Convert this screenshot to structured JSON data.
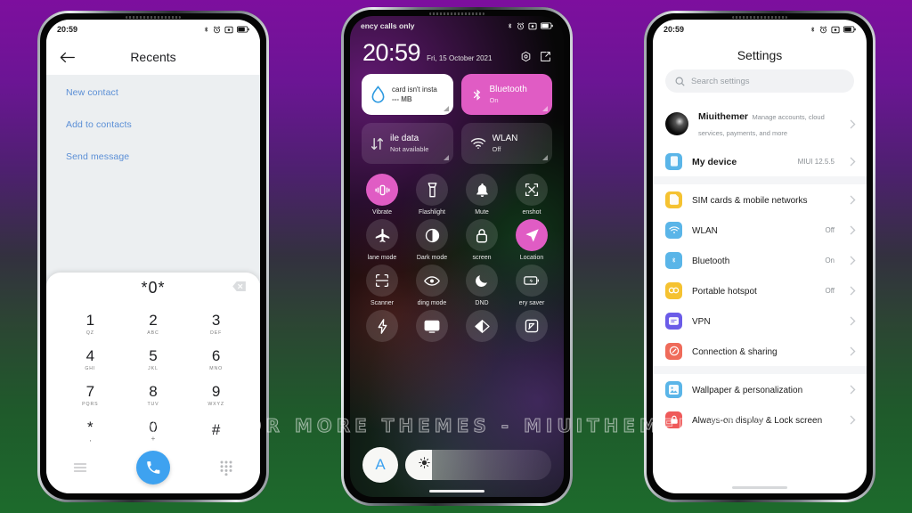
{
  "watermark": "VISIT FOR MORE THEMES - MIUITHEMER.COM",
  "theme": {
    "accent_pink": "#e05cc4",
    "accent_blue": "#3ea2f0",
    "bg_top": "#7d0f9e",
    "bg_bottom": "#1d6b2c"
  },
  "phone_left": {
    "status": {
      "time": "20:59"
    },
    "appbar": {
      "title": "Recents",
      "back_icon": "back-arrow-icon"
    },
    "links": [
      {
        "label": "New contact"
      },
      {
        "label": "Add to contacts"
      },
      {
        "label": "Send message"
      }
    ],
    "dialer": {
      "number": "*0*",
      "backspace_icon": "backspace-icon",
      "keys": [
        {
          "digit": "1",
          "sub": "QZ"
        },
        {
          "digit": "2",
          "sub": "ABC"
        },
        {
          "digit": "3",
          "sub": "DEF"
        },
        {
          "digit": "4",
          "sub": "GHI"
        },
        {
          "digit": "5",
          "sub": "JKL"
        },
        {
          "digit": "6",
          "sub": "MNO"
        },
        {
          "digit": "7",
          "sub": "PQRS"
        },
        {
          "digit": "8",
          "sub": "TUV"
        },
        {
          "digit": "9",
          "sub": "WXYZ"
        },
        {
          "digit": "*",
          "sub": ","
        },
        {
          "digit": "0",
          "sub": "+"
        },
        {
          "digit": "#",
          "sub": ""
        }
      ],
      "menu_icon": "menu-icon",
      "call_icon": "phone-call-icon",
      "keypad_icon": "keypad-grid-icon"
    }
  },
  "phone_center": {
    "status": {
      "carrier": "ency calls only"
    },
    "clock": {
      "time": "20:59",
      "date": "Fri, 15 October 2021",
      "settings_icon": "gear-icon",
      "edit_icon": "edit-pencil-icon"
    },
    "big_tiles": [
      {
        "title": "card isn't insta",
        "sub": "--- MB",
        "icon": "data-drop-icon",
        "style": "white"
      },
      {
        "title": "Bluetooth",
        "sub": "On",
        "icon": "bluetooth-icon",
        "style": "pink"
      },
      {
        "title": "ile data",
        "sub": "Not available",
        "icon": "mobile-data-icon",
        "style": "dim"
      },
      {
        "title": "WLAN",
        "sub": "Off",
        "icon": "wifi-icon",
        "style": "dim"
      }
    ],
    "toggles": [
      {
        "label": "Vibrate",
        "icon": "vibrate-icon",
        "on": true
      },
      {
        "label": "Flashlight",
        "icon": "flashlight-icon",
        "on": false
      },
      {
        "label": "Mute",
        "icon": "bell-icon",
        "on": false
      },
      {
        "label": "enshot",
        "icon": "screenshot-icon",
        "on": false
      },
      {
        "label": "lane mode",
        "icon": "airplane-icon",
        "on": false
      },
      {
        "label": "Dark mode",
        "icon": "dark-mode-icon",
        "on": false
      },
      {
        "label": "screen",
        "icon": "lock-icon",
        "on": false
      },
      {
        "label": "Location",
        "icon": "location-arrow-icon",
        "on": true
      },
      {
        "label": "Scanner",
        "icon": "scanner-icon",
        "on": false
      },
      {
        "label": "ding mode",
        "icon": "eye-icon",
        "on": false
      },
      {
        "label": "DND",
        "icon": "moon-icon",
        "on": false
      },
      {
        "label": "ery saver",
        "icon": "battery-saver-icon",
        "on": false
      },
      {
        "label": "",
        "icon": "lightning-icon",
        "on": false
      },
      {
        "label": "",
        "icon": "cast-screen-icon",
        "on": false
      },
      {
        "label": "",
        "icon": "reading-tint-icon",
        "on": false
      },
      {
        "label": "",
        "icon": "rotate-screen-icon",
        "on": false
      }
    ],
    "brightness": {
      "auto_label": "A",
      "auto_icon": "auto-brightness-icon",
      "slider_icon": "brightness-sun-icon",
      "level_percent": 18
    }
  },
  "phone_right": {
    "status": {
      "time": "20:59"
    },
    "title": "Settings",
    "search": {
      "placeholder": "Search settings",
      "icon": "search-icon"
    },
    "account": {
      "name": "Miuithemer",
      "sub": "Manage accounts, cloud services, payments, and more",
      "avatar": "avatar"
    },
    "groups": [
      {
        "rows": [
          {
            "label": "My device",
            "value": "MIUI 12.5.5",
            "icon": "device-icon",
            "color": "#5ab5e8"
          }
        ]
      },
      {
        "rows": [
          {
            "label": "SIM cards & mobile networks",
            "value": "",
            "icon": "sim-card-icon",
            "color": "#f5c231"
          },
          {
            "label": "WLAN",
            "value": "Off",
            "icon": "wifi-icon",
            "color": "#5ab5e8"
          },
          {
            "label": "Bluetooth",
            "value": "On",
            "icon": "bluetooth-icon",
            "color": "#5ab5e8"
          },
          {
            "label": "Portable hotspot",
            "value": "Off",
            "icon": "hotspot-icon",
            "color": "#f5c231"
          },
          {
            "label": "VPN",
            "value": "",
            "icon": "vpn-icon",
            "color": "#6b5ce8"
          },
          {
            "label": "Connection & sharing",
            "value": "",
            "icon": "connection-sharing-icon",
            "color": "#ef6b5a"
          }
        ]
      },
      {
        "rows": [
          {
            "label": "Wallpaper & personalization",
            "value": "",
            "icon": "wallpaper-icon",
            "color": "#5ab5e8"
          },
          {
            "label": "Always-on display & Lock screen",
            "value": "",
            "icon": "lock-screen-icon",
            "color": "#ef5a5a"
          }
        ]
      }
    ]
  }
}
